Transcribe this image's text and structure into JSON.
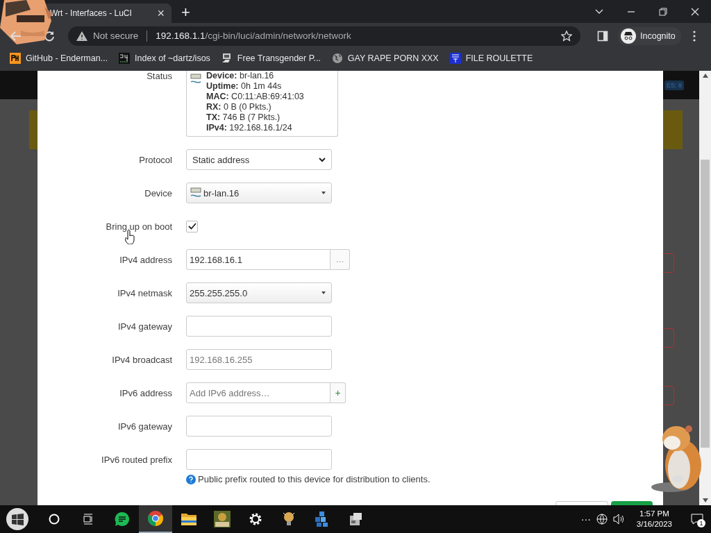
{
  "browser": {
    "tab": {
      "title": "Wrt - Interfaces - LuCI",
      "close": "×",
      "new_tab": "+"
    },
    "address": {
      "security": "Not secure",
      "host": "192.168.1.1",
      "path": "/cgi-bin/luci/admin/network/network"
    },
    "profile": "Incognito",
    "bookmarks": [
      {
        "kind": "ph",
        "label": "GitHub - Enderman..."
      },
      {
        "kind": "digits",
        "label": "Index of ~dartz/isos"
      },
      {
        "kind": "network",
        "label": "Free Transgender P..."
      },
      {
        "kind": "globe",
        "label": "GAY RAPE PORN XXX"
      },
      {
        "kind": "mft",
        "label": "FILE ROULETTE"
      }
    ]
  },
  "backdrop": {
    "badge": "ES: 8"
  },
  "modal": {
    "status": {
      "label": "Status",
      "lines": [
        {
          "key": "Device:",
          "value": "br-lan.16"
        },
        {
          "key": "Uptime:",
          "value": "0h 1m 44s"
        },
        {
          "key": "MAC:",
          "value": "C0:11:AB:69:41:03"
        },
        {
          "key": "RX:",
          "value": "0 B (0 Pkts.)"
        },
        {
          "key": "TX:",
          "value": "746 B (7 Pkts.)"
        },
        {
          "key": "IPv4:",
          "value": "192.168.16.1/24"
        }
      ]
    },
    "fields": [
      {
        "label": "Protocol",
        "kind": "select",
        "value": "Static address"
      },
      {
        "label": "Device",
        "kind": "device",
        "value": "br-lan.16"
      },
      {
        "label": "Bring up on boot",
        "kind": "checkbox",
        "checked": true
      },
      {
        "label": "IPv4 address",
        "kind": "text-button",
        "value": "192.168.16.1",
        "button": "…"
      },
      {
        "label": "IPv4 netmask",
        "kind": "dropdown",
        "value": "255.255.255.0"
      },
      {
        "label": "IPv4 gateway",
        "kind": "text"
      },
      {
        "label": "IPv4 broadcast",
        "kind": "text",
        "placeholder": "192.168.16.255"
      },
      {
        "label": "IPv6 address",
        "kind": "text-button",
        "placeholder": "Add IPv6 address…",
        "button": "+"
      },
      {
        "label": "IPv6 gateway",
        "kind": "text"
      },
      {
        "label": "IPv6 routed prefix",
        "kind": "text",
        "help": "Public prefix routed to this device for distribution to clients."
      }
    ]
  },
  "taskbar": {
    "apps": [
      {
        "kind": "chat",
        "selected": false
      },
      {
        "kind": "chrome",
        "selected": true
      },
      {
        "kind": "folder",
        "selected": false
      },
      {
        "kind": "game",
        "selected": false
      },
      {
        "kind": "gear",
        "selected": false
      },
      {
        "kind": "bulb",
        "selected": false
      },
      {
        "kind": "cubes",
        "selected": false
      },
      {
        "kind": "device",
        "selected": false
      }
    ],
    "overflow": "···",
    "time": "1:57 PM",
    "date": "3/16/2023",
    "notifications": "1"
  }
}
